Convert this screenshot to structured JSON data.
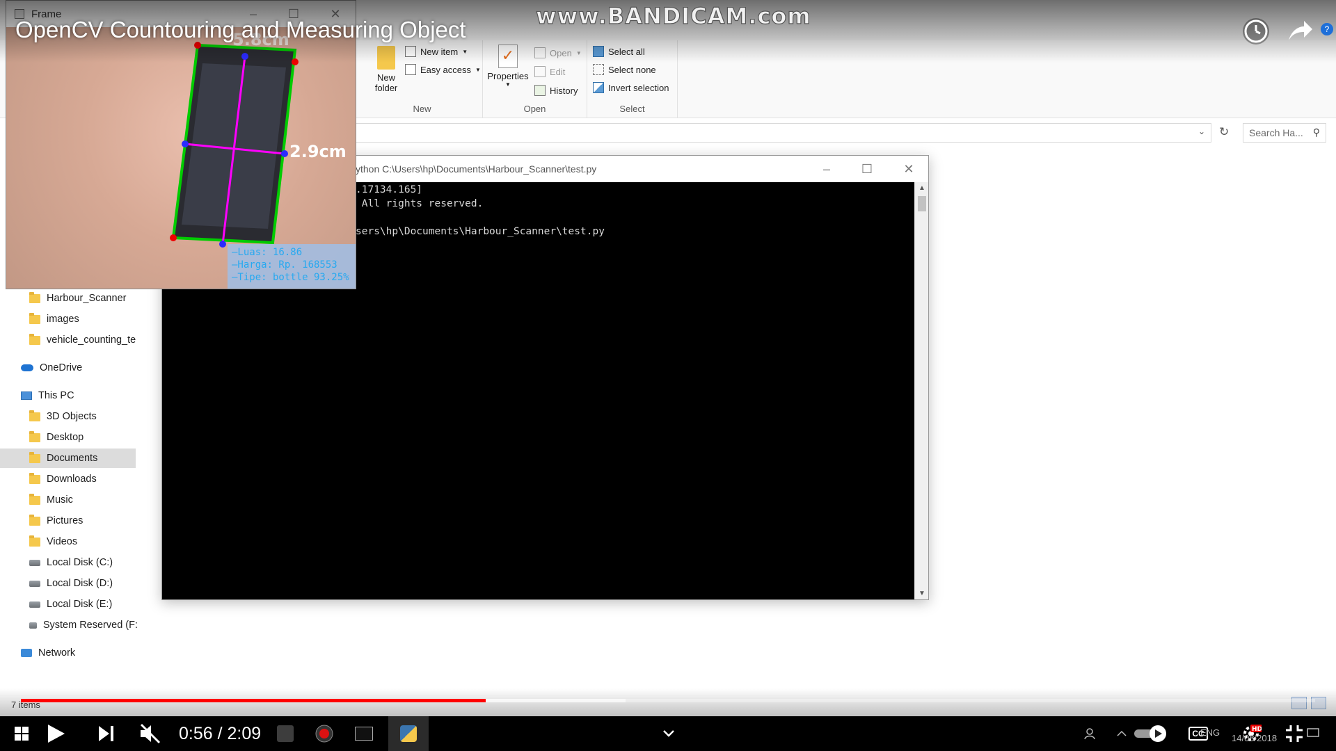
{
  "explorer": {
    "ribbon": {
      "new_group": {
        "label": "New",
        "new_folder": "New\nfolder",
        "new_item": "New item",
        "easy_access": "Easy access"
      },
      "open_group": {
        "label": "Open",
        "properties": "Properties",
        "open": "Open",
        "edit": "Edit",
        "history": "History"
      },
      "select_group": {
        "label": "Select",
        "select_all": "Select all",
        "select_none": "Select none",
        "invert_selection": "Invert selection"
      }
    },
    "search_placeholder": "Search Ha...",
    "nav": [
      {
        "label": "Harbour_Scanner",
        "kind": "folder"
      },
      {
        "label": "images",
        "kind": "folder"
      },
      {
        "label": "vehicle_counting_te",
        "kind": "folder"
      },
      {
        "label": "OneDrive",
        "kind": "cloud"
      },
      {
        "label": "This PC",
        "kind": "pc"
      },
      {
        "label": "3D Objects",
        "kind": "folder"
      },
      {
        "label": "Desktop",
        "kind": "folder"
      },
      {
        "label": "Documents",
        "kind": "folder",
        "selected": true
      },
      {
        "label": "Downloads",
        "kind": "folder"
      },
      {
        "label": "Music",
        "kind": "folder"
      },
      {
        "label": "Pictures",
        "kind": "folder"
      },
      {
        "label": "Videos",
        "kind": "folder"
      },
      {
        "label": "Local Disk (C:)",
        "kind": "drive"
      },
      {
        "label": "Local Disk (D:)",
        "kind": "drive"
      },
      {
        "label": "Local Disk (E:)",
        "kind": "drive"
      },
      {
        "label": "System Reserved (F:",
        "kind": "drive"
      },
      {
        "label": "Network",
        "kind": "network"
      }
    ],
    "status": "7 items"
  },
  "cmd": {
    "title": "ython  C:\\Users\\hp\\Documents\\Harbour_Scanner\\test.py",
    "lines": [
      ".17134.165]",
      " All rights reserved.",
      "",
      "sers\\hp\\Documents\\Harbour_Scanner\\test.py"
    ]
  },
  "frame": {
    "title": "Frame",
    "measure_top": "5.8cm",
    "measure_right": "2.9cm",
    "info": [
      "—Luas: 16.86",
      "—Harga: Rp. 168553",
      "—Tipe: bottle 93.25%"
    ]
  },
  "video": {
    "title": "OpenCV Countouring and Measuring Object",
    "watermark": "www.BANDICAM.com",
    "time": "0:56 / 2:09",
    "progress_played": 0.359,
    "progress_buffered": 0.467
  },
  "system_tray": {
    "lang": "ENG",
    "date": "14/08/2018"
  },
  "colors": {
    "progress": "#ff0000",
    "measure_line": "#ff00ff",
    "contour": "#00cc00"
  }
}
